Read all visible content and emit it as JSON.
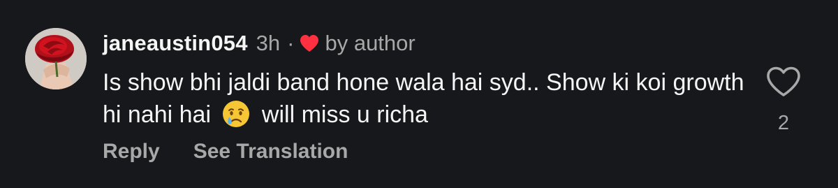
{
  "comment": {
    "username": "janeaustin054",
    "time": "3h",
    "separator": "·",
    "liked_by_label": "by author",
    "text_before_emoji": "Is show bhi jaldi band hone wala hai syd.. Show ki koi growth hi nahi hai",
    "emoji": "crying-face-icon",
    "text_after_emoji": "will miss u richa",
    "like_count": "2"
  },
  "actions": {
    "reply_label": "Reply",
    "translate_label": "See Translation"
  },
  "colors": {
    "background": "#17181c",
    "primary_text": "#f5f5f5",
    "secondary_text": "#a8a8a8",
    "heart_red": "#ff3040"
  }
}
